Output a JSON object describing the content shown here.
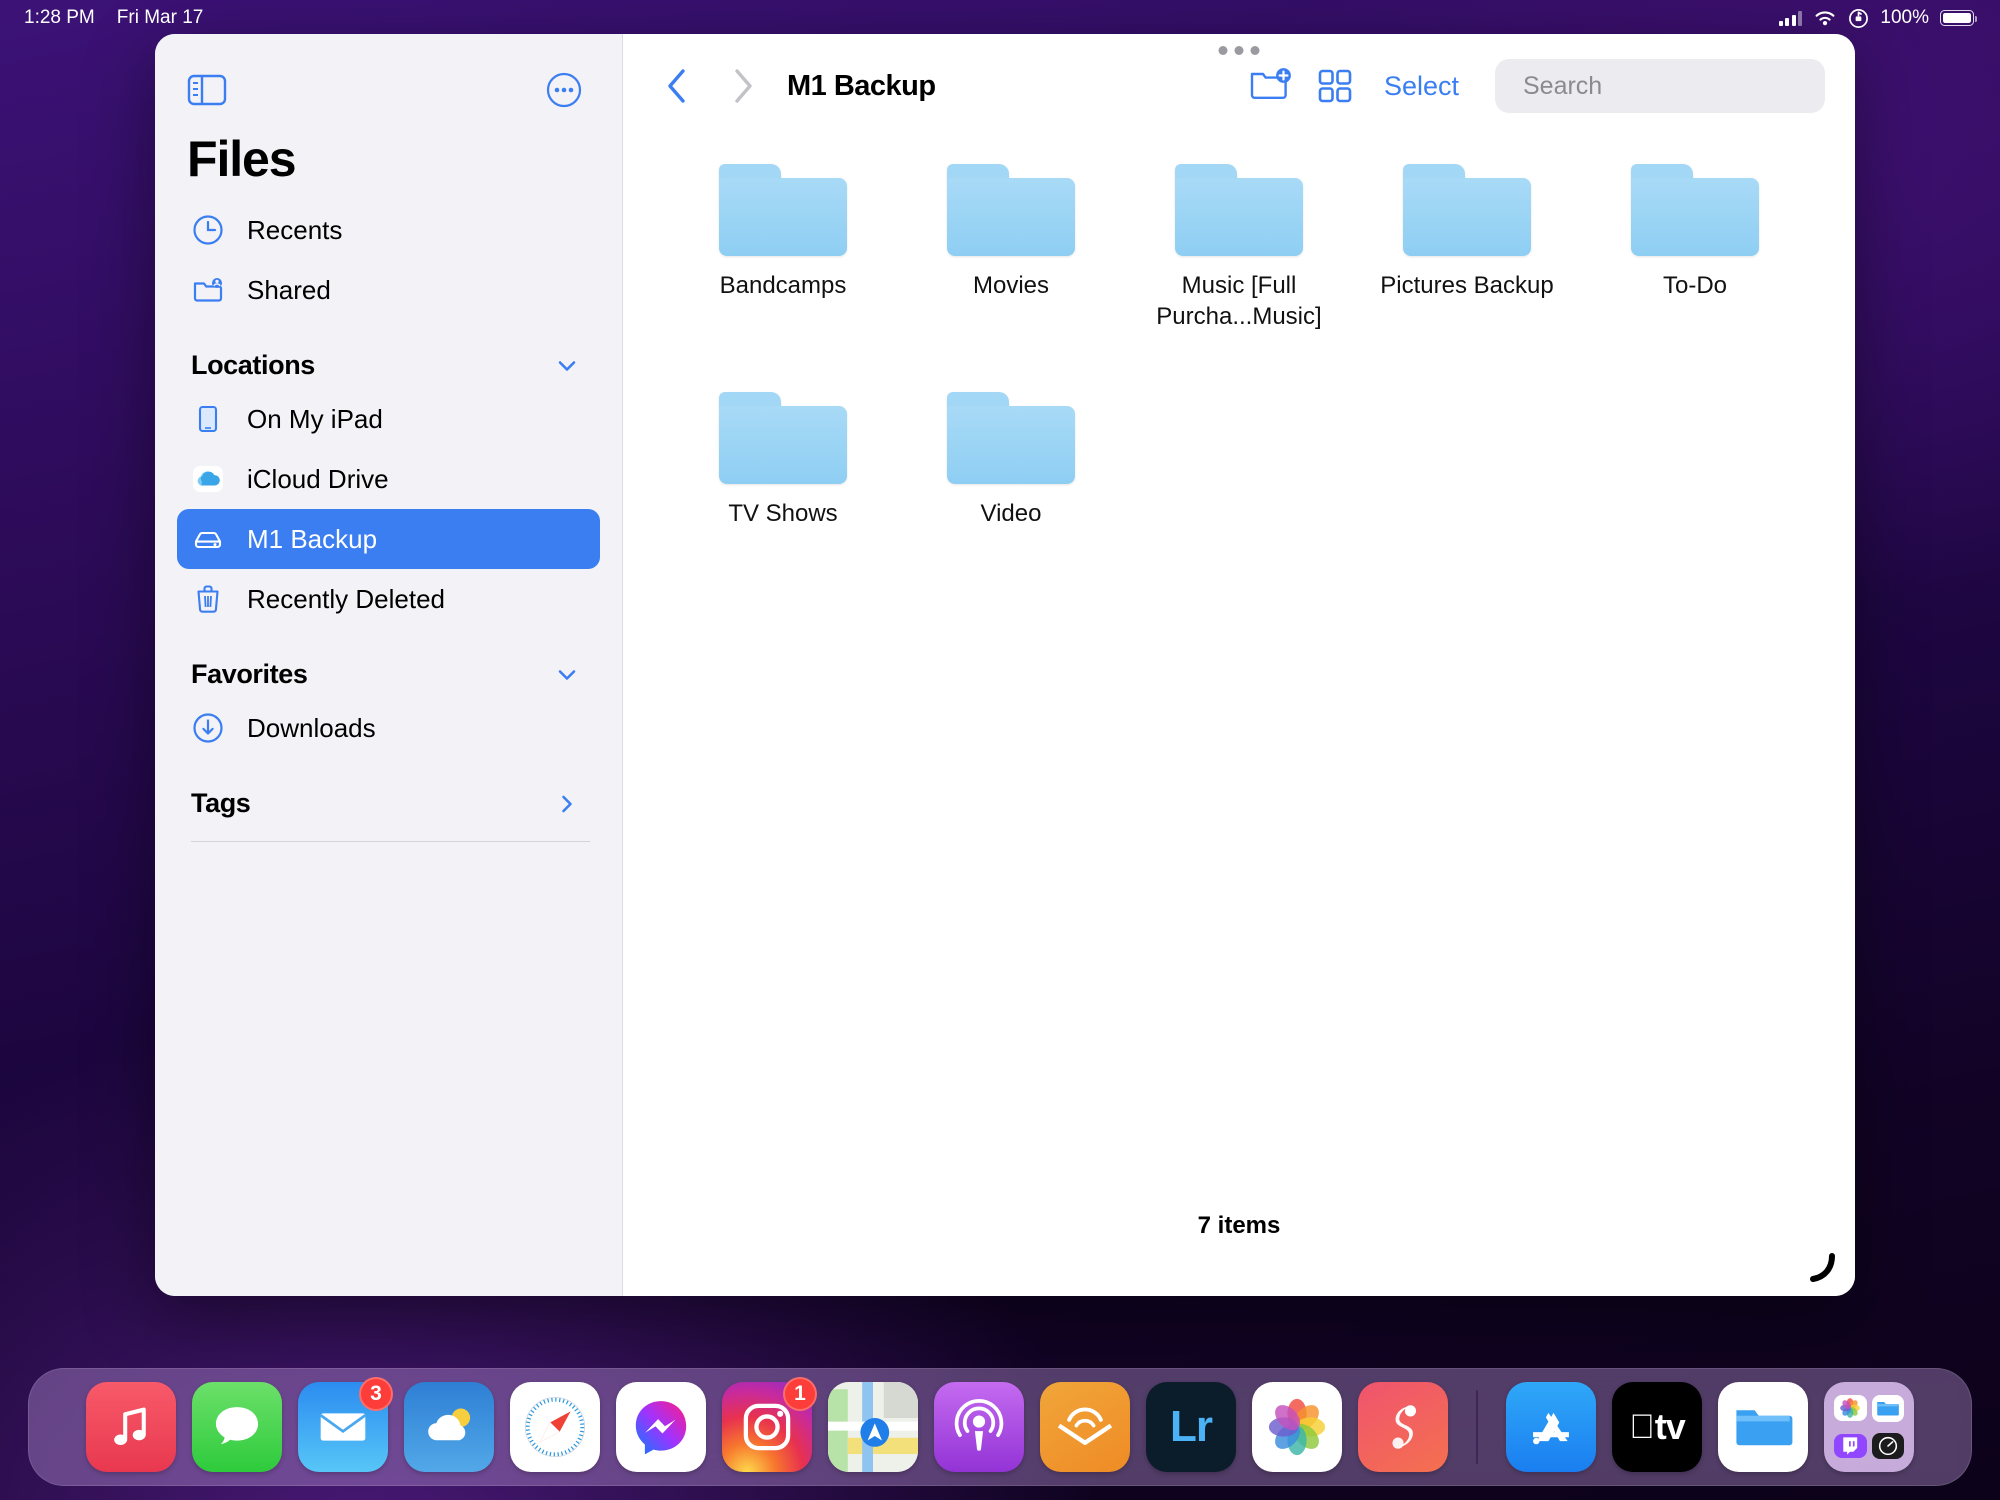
{
  "statusbar": {
    "time": "1:28 PM",
    "date": "Fri Mar 17",
    "battery_percent": "100%",
    "icons": [
      "cellular-signal-icon",
      "wifi-icon",
      "rotation-lock-icon",
      "battery-icon"
    ]
  },
  "sidebar": {
    "title": "Files",
    "toggle_icon": "sidebar-toggle-icon",
    "more_icon": "more-circle-icon",
    "top_items": [
      {
        "label": "Recents",
        "icon": "clock-icon"
      },
      {
        "label": "Shared",
        "icon": "shared-folder-icon"
      }
    ],
    "locations": {
      "header": "Locations",
      "collapse_icon": "chevron-down-icon",
      "items": [
        {
          "label": "On My iPad",
          "icon": "ipad-icon",
          "selected": false
        },
        {
          "label": "iCloud Drive",
          "icon": "icloud-icon",
          "selected": false
        },
        {
          "label": "M1 Backup",
          "icon": "external-drive-icon",
          "selected": true
        },
        {
          "label": "Recently Deleted",
          "icon": "trash-icon",
          "selected": false
        }
      ]
    },
    "favorites": {
      "header": "Favorites",
      "collapse_icon": "chevron-down-icon",
      "items": [
        {
          "label": "Downloads",
          "icon": "download-circle-icon",
          "selected": false
        }
      ]
    },
    "tags": {
      "header": "Tags",
      "disclosure_icon": "chevron-right-icon"
    }
  },
  "toolbar": {
    "back_icon": "chevron-left-icon",
    "forward_icon": "chevron-right-icon",
    "title": "M1 Backup",
    "new_folder_icon": "new-folder-icon",
    "view_grid_icon": "grid-view-icon",
    "select_label": "Select",
    "search": {
      "placeholder": "Search",
      "value": "",
      "search_icon": "search-icon",
      "dictation_icon": "microphone-icon"
    }
  },
  "content": {
    "items": [
      {
        "name": "Bandcamps",
        "icon": "folder-icon"
      },
      {
        "name": "Movies",
        "icon": "folder-icon"
      },
      {
        "name": "Music [Full Purcha...Music]",
        "icon": "folder-icon"
      },
      {
        "name": "Pictures Backup",
        "icon": "folder-icon"
      },
      {
        "name": "To-Do",
        "icon": "folder-icon"
      },
      {
        "name": "TV Shows",
        "icon": "folder-icon"
      },
      {
        "name": "Video",
        "icon": "folder-icon"
      }
    ],
    "item_count_label": "7 items",
    "resize_handle_icon": "resize-handle-icon"
  },
  "dock": {
    "apps": [
      {
        "name": "Music",
        "icon": "music-app-icon",
        "badge": null
      },
      {
        "name": "Messages",
        "icon": "messages-app-icon",
        "badge": null
      },
      {
        "name": "Mail",
        "icon": "mail-app-icon",
        "badge": "3"
      },
      {
        "name": "Weather",
        "icon": "weather-app-icon",
        "badge": null
      },
      {
        "name": "Safari",
        "icon": "safari-app-icon",
        "badge": null
      },
      {
        "name": "Messenger",
        "icon": "messenger-app-icon",
        "badge": null
      },
      {
        "name": "Instagram",
        "icon": "instagram-app-icon",
        "badge": "1"
      },
      {
        "name": "Maps",
        "icon": "maps-app-icon",
        "badge": null
      },
      {
        "name": "Podcasts",
        "icon": "podcasts-app-icon",
        "badge": null
      },
      {
        "name": "Audible",
        "icon": "audible-app-icon",
        "badge": null
      },
      {
        "name": "Lightroom",
        "icon": "lightroom-app-icon",
        "badge": null,
        "glyph": "Lr"
      },
      {
        "name": "Photos",
        "icon": "photos-app-icon",
        "badge": null
      },
      {
        "name": "Spark",
        "icon": "spark-app-icon",
        "badge": null
      },
      {
        "name": "App Store",
        "icon": "appstore-app-icon",
        "badge": null
      },
      {
        "name": "Apple TV",
        "icon": "appletv-app-icon",
        "badge": null,
        "glyph": "tv"
      },
      {
        "name": "Files",
        "icon": "files-app-icon",
        "badge": null
      },
      {
        "name": "Recent Apps",
        "icon": "recent-apps-stack-icon",
        "badge": null
      }
    ]
  }
}
